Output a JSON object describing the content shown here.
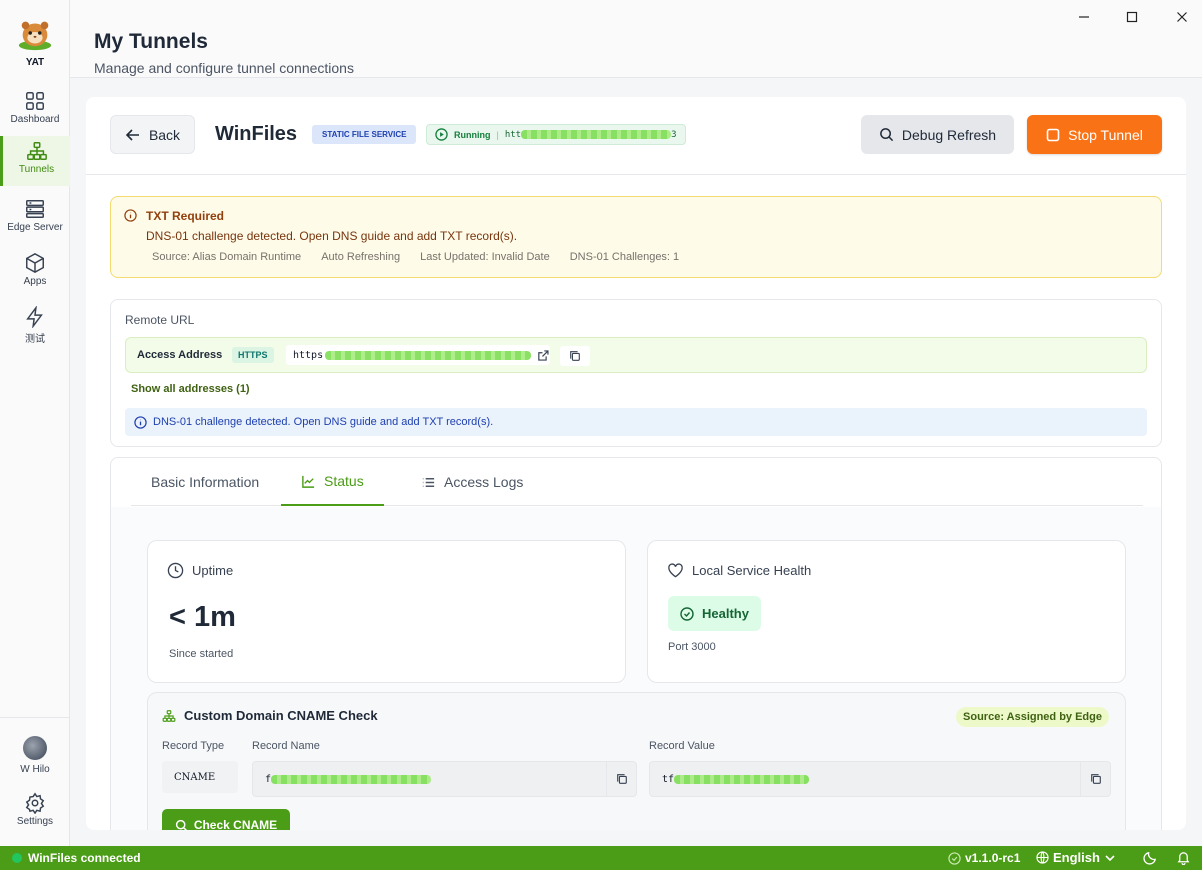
{
  "sidebar": {
    "brand": "YAT",
    "items": [
      {
        "label": "Dashboard",
        "icon": "grid-icon"
      },
      {
        "label": "Tunnels",
        "icon": "network-icon"
      },
      {
        "label": "Edge Server",
        "icon": "server-icon"
      },
      {
        "label": "Apps",
        "icon": "cube-icon"
      },
      {
        "label": "测试",
        "icon": "lightning-icon"
      }
    ],
    "active_item": "Tunnels",
    "user": {
      "name": "W Hilo"
    },
    "settings_label": "Settings"
  },
  "header": {
    "title": "My Tunnels",
    "subtitle": "Manage and configure tunnel connections"
  },
  "toolbar": {
    "back_label": "Back",
    "tunnel_name": "WinFiles",
    "type_badge": "STATIC FILE SERVICE",
    "status": "Running",
    "status_sep": "|",
    "status_url_prefix": "htt",
    "status_url_suffix": "3",
    "debug_label": "Debug Refresh",
    "stop_label": "Stop Tunnel"
  },
  "alert": {
    "title": "TXT Required",
    "message": "DNS-01 challenge detected. Open DNS guide and add TXT record(s).",
    "meta": {
      "source": "Source: Alias Domain Runtime",
      "refresh": "Auto Refreshing",
      "updated": "Last Updated: Invalid Date",
      "challenges": "DNS-01 Challenges: 1"
    }
  },
  "remote": {
    "title": "Remote URL",
    "access_label": "Access Address",
    "protocol": "HTTPS",
    "address_prefix": "https",
    "show_all": "Show all addresses (1)",
    "info": "DNS-01 challenge detected. Open DNS guide and add TXT record(s)."
  },
  "tabs": [
    {
      "label": "Basic Information"
    },
    {
      "label": "Status"
    },
    {
      "label": "Access Logs"
    }
  ],
  "active_tab": "Status",
  "uptime": {
    "title": "Uptime",
    "value": "< 1m",
    "caption": "Since started"
  },
  "health": {
    "title": "Local Service Health",
    "status": "Healthy",
    "port": "Port 3000"
  },
  "cname": {
    "title": "Custom Domain CNAME Check",
    "source": "Source: Assigned by Edge",
    "columns": [
      "Record Type",
      "Record Name",
      "Record Value"
    ],
    "record_type": "CNAME",
    "record_name_prefix": "f",
    "record_value_prefix": "tf",
    "check_label": "Check CNAME"
  },
  "statusbar": {
    "connection": "WinFiles connected",
    "version": "v1.1.0-rc1",
    "language": "English"
  },
  "colors": {
    "accent": "#4b9c16",
    "stop": "#f97316",
    "alert_bg": "#fefbe8"
  }
}
